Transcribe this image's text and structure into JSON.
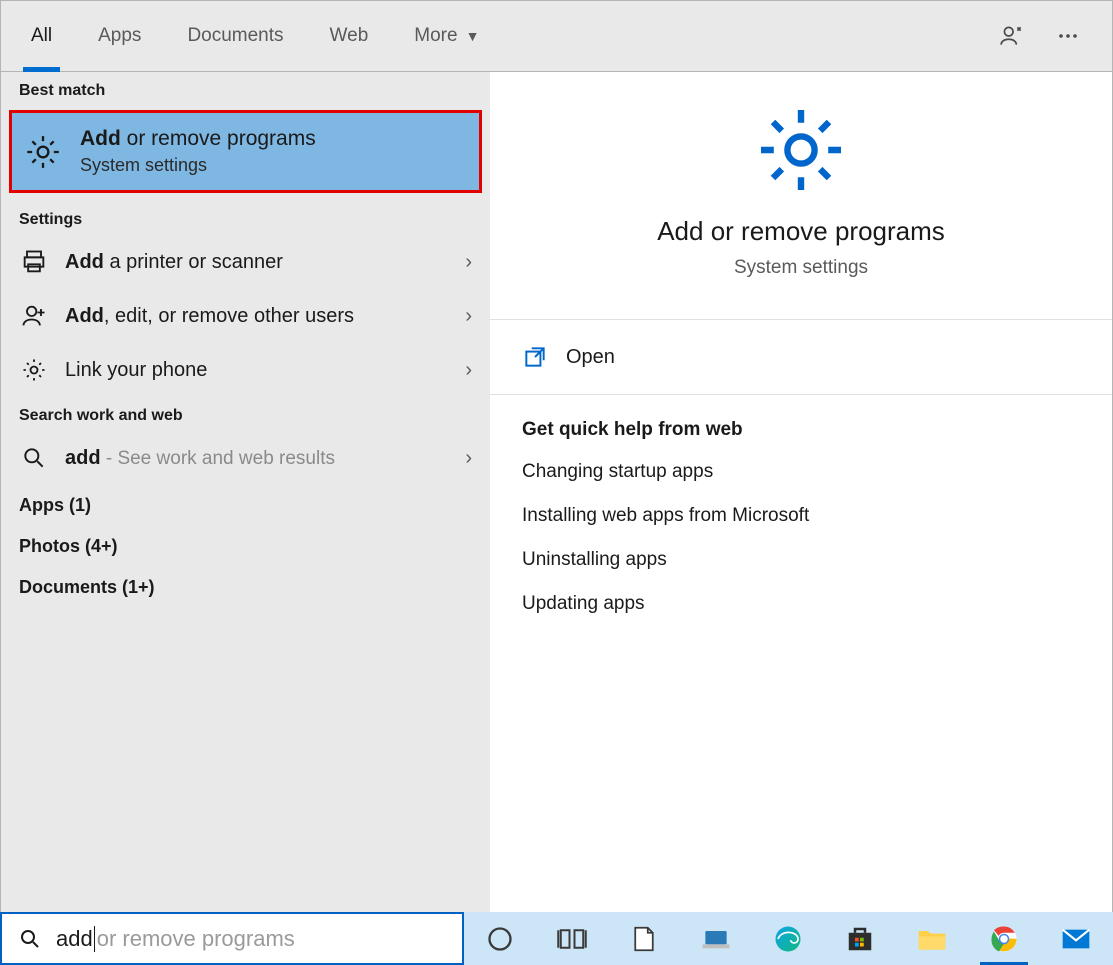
{
  "tabs": {
    "all": "All",
    "apps": "Apps",
    "documents": "Documents",
    "web": "Web",
    "more": "More"
  },
  "sections": {
    "best_match": "Best match",
    "settings": "Settings",
    "search_web": "Search work and web",
    "apps_cat": "Apps (1)",
    "photos_cat": "Photos (4+)",
    "docs_cat": "Documents (1+)"
  },
  "best": {
    "title_bold": "Add",
    "title_rest": " or remove programs",
    "subtitle": "System settings"
  },
  "settings_items": [
    {
      "bold": "Add",
      "rest": " a printer or scanner",
      "icon": "printer"
    },
    {
      "bold": "Add",
      "rest": ", edit, or remove other users",
      "icon": "person-plus"
    },
    {
      "bold": "",
      "rest": "Link your phone",
      "icon": "gear"
    }
  ],
  "web_item": {
    "bold": "add",
    "suffix": " - See work and web results"
  },
  "preview": {
    "title": "Add or remove programs",
    "subtitle": "System settings",
    "open": "Open",
    "help_hd": "Get quick help from web",
    "links": [
      "Changing startup apps",
      "Installing web apps from Microsoft",
      "Uninstalling apps",
      "Updating apps"
    ]
  },
  "search": {
    "typed": "add",
    "suggest": " or remove programs"
  }
}
